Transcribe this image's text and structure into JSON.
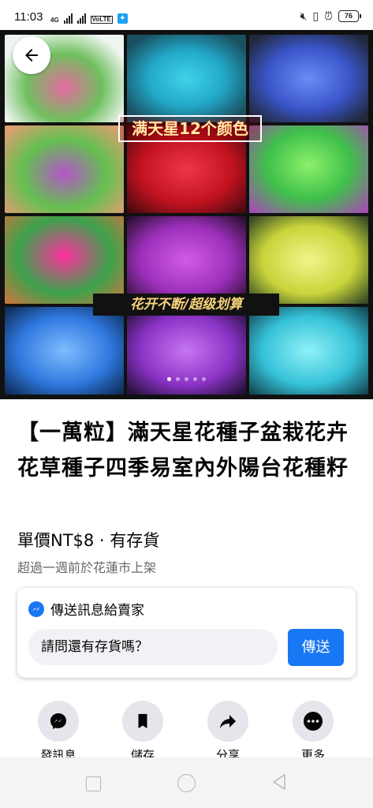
{
  "status_bar": {
    "time": "11:03",
    "network_label": "4G",
    "volte_label": "VoLTE",
    "battery": "76"
  },
  "product_image": {
    "overlay_title": "满天星12个颜色",
    "overlay_banner": "花开不断/超级划算",
    "page_count": 5,
    "active_page": 1
  },
  "listing": {
    "title": "【一萬粒】滿天星花種子盆栽花卉花草種子四季易室內外陽台花種籽",
    "price_line": "單價NT$8 · 有存貨",
    "listed_line": "超過一週前於花蓮市上架"
  },
  "message_card": {
    "header": "傳送訊息給賣家",
    "input_value": "請問還有存貨嗎？",
    "send_label": "傳送"
  },
  "actions": {
    "message": "發訊息",
    "save": "儲存",
    "share": "分享",
    "more": "更多"
  },
  "colors": {
    "accent": "#1877f2",
    "action_bg": "#e4e6eb",
    "input_bg": "#f0f2f5"
  }
}
